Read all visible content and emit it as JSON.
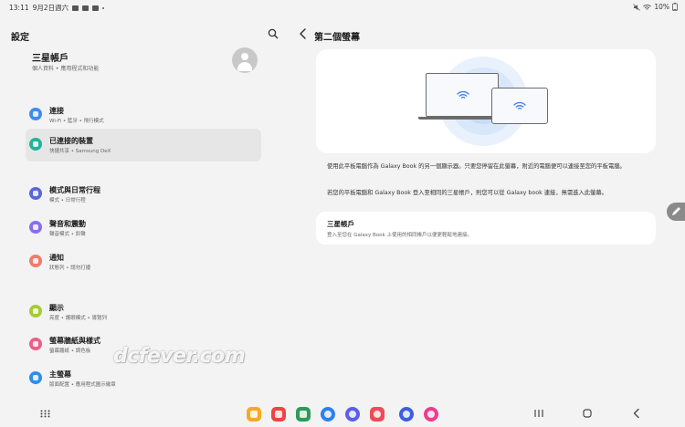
{
  "status_bar": {
    "time": "13:11",
    "date": "9月2日週六",
    "battery": "10%"
  },
  "settings": {
    "title": "設定",
    "account": {
      "name": "三星帳戶",
      "sub": "個人資料 • 應用程式和功能"
    },
    "items": [
      {
        "label": "連接",
        "sub": "Wi-Fi • 藍牙 • 飛行模式",
        "color": "#3f8cf0",
        "icon": "wifi-icon"
      },
      {
        "label": "已連接的裝置",
        "sub": "快捷共享 • Samsung DeX",
        "color": "#24b39a",
        "icon": "connected-devices-icon"
      },
      {
        "label": "模式與日常行程",
        "sub": "模式 • 日常行程",
        "color": "#5a67d8",
        "icon": "modes-icon"
      },
      {
        "label": "聲音和震動",
        "sub": "聲音模式 • 鈴聲",
        "color": "#8b6cf0",
        "icon": "sound-icon"
      },
      {
        "label": "通知",
        "sub": "狀態列 • 請勿打擾",
        "color": "#ef7b6b",
        "icon": "notification-icon"
      },
      {
        "label": "顯示",
        "sub": "亮度 • 護眼模式 • 導覽列",
        "color": "#a5cc2e",
        "icon": "display-icon"
      },
      {
        "label": "螢幕牆紙與樣式",
        "sub": "螢幕牆紙 • 調色板",
        "color": "#ec5f85",
        "icon": "wallpaper-icon"
      },
      {
        "label": "主螢幕",
        "sub": "版面配置 • 應用程式圖示徽章",
        "color": "#2f8fe8",
        "icon": "home-screen-icon"
      }
    ]
  },
  "detail": {
    "title": "第二個螢幕",
    "desc1": "使用此平板電腦作為 Galaxy Book 的另一個顯示器。只要您停留在此螢幕，附近的電腦便可以連接至您的平板電腦。",
    "desc2": "若您的平板電腦和 Galaxy Book 登入至相同的三星帳戶，則您可以從 Galaxy book 連接，無需進入此螢幕。",
    "account_card": {
      "title": "三星帳戶",
      "sub": "登入至您在 Galaxy Book 上使用的相同帳戶以便更輕鬆地連接。"
    }
  },
  "watermark": "dcfever.com",
  "dock": [
    {
      "name": "my-files-app",
      "color": "#f7a823"
    },
    {
      "name": "notes-app",
      "color": "#ef4343"
    },
    {
      "name": "calendar-app",
      "color": "#2c9b57"
    },
    {
      "name": "messages-app",
      "color": "#2f7ff0"
    },
    {
      "name": "internet-app",
      "color": "#5b5ee8"
    },
    {
      "name": "camera-app",
      "color": "#ee4b5a"
    },
    {
      "name": "clock-app",
      "color": "#3b5fe0"
    },
    {
      "name": "blossom-app",
      "color": "#ec3d8f"
    }
  ]
}
